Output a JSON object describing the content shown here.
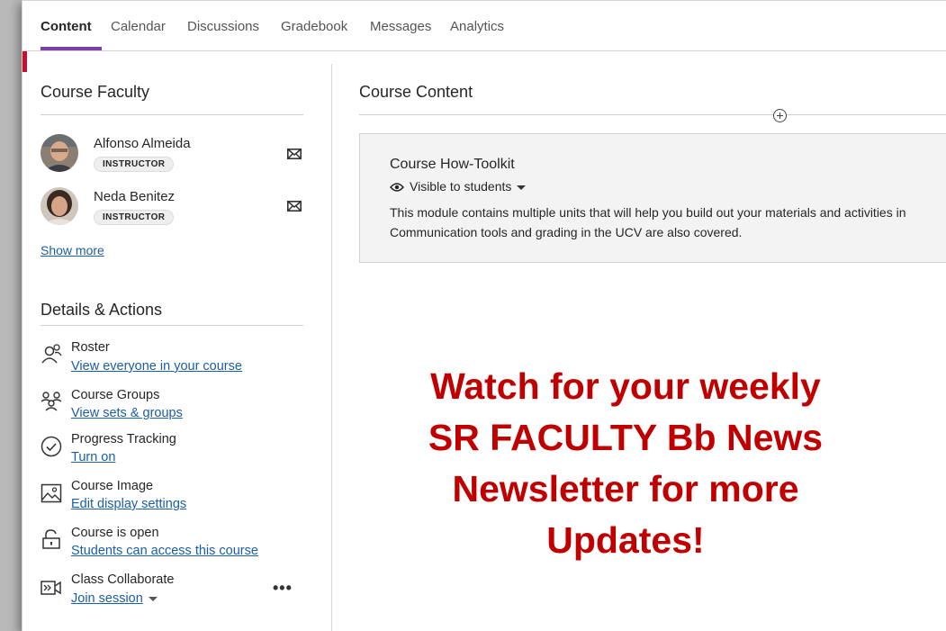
{
  "nav": {
    "tabs": [
      {
        "label": "Content"
      },
      {
        "label": "Calendar"
      },
      {
        "label": "Discussions"
      },
      {
        "label": "Gradebook"
      },
      {
        "label": "Messages"
      },
      {
        "label": "Analytics"
      }
    ],
    "active_tab": "Content"
  },
  "faculty": {
    "title": "Course Faculty",
    "members": [
      {
        "name": "Alfonso Almeida",
        "role": "INSTRUCTOR"
      },
      {
        "name": "Neda Benitez",
        "role": "INSTRUCTOR"
      }
    ],
    "show_more": "Show more"
  },
  "details": {
    "title": "Details & Actions",
    "items": [
      {
        "title": "Roster",
        "link": "View everyone in your course",
        "icon": "roster-icon"
      },
      {
        "title": "Course Groups",
        "link": "View sets & groups",
        "icon": "groups-icon"
      },
      {
        "title": "Progress Tracking",
        "link": "Turn on",
        "icon": "progress-check-icon"
      },
      {
        "title": "Course Image",
        "link": "Edit display settings",
        "icon": "image-icon"
      },
      {
        "title": "Course is open",
        "link": "Students can access this course",
        "icon": "unlock-icon"
      },
      {
        "title": "Class Collaborate",
        "link": "Join session",
        "icon": "collaborate-icon"
      }
    ],
    "more": "•••"
  },
  "content": {
    "title": "Course Content",
    "module": {
      "title": "Course How-Toolkit",
      "visibility": "Visible to students",
      "description_line1": "This module contains multiple units that will help you build out your materials and activities in",
      "description_line2": "Communication tools and grading in the UCV are also covered."
    }
  },
  "banner": {
    "lines": [
      "Watch for your weekly",
      "SR FACULTY Bb News",
      "Newsletter for more",
      "Updates!"
    ]
  },
  "colors": {
    "accent_purple": "#7d3fa6",
    "link_blue": "#1a5ea8",
    "banner_red": "#c00000",
    "marker_red": "#c8102e"
  }
}
